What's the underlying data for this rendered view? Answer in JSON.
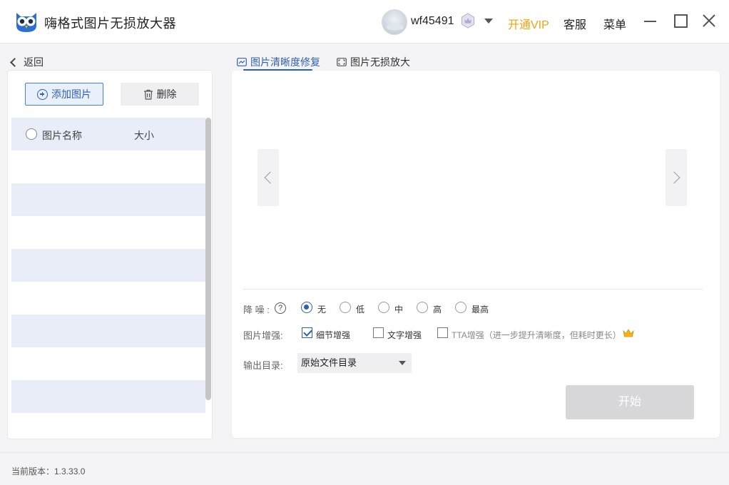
{
  "app": {
    "title": "嗨格式图片无损放大器"
  },
  "account": {
    "username": "wf45491",
    "vip_label": "开通VIP",
    "service_label": "客服",
    "menu_label": "菜单"
  },
  "nav": {
    "back_label": "返回"
  },
  "file_list": {
    "add_label": "添加图片",
    "delete_label": "删除",
    "col_name": "图片名称",
    "col_size": "大小"
  },
  "tabs": [
    {
      "label": "图片清晰度修复",
      "active": true
    },
    {
      "label": "图片无损放大",
      "active": false
    }
  ],
  "options": {
    "denoise_label": "降 噪 :",
    "denoise_levels": [
      "无",
      "低",
      "中",
      "高",
      "最高"
    ],
    "denoise_selected": "无",
    "enhance_label": "图片增强:",
    "enhance_items": [
      {
        "label": "细节增强",
        "checked": true
      },
      {
        "label": "文字增强",
        "checked": false
      },
      {
        "label": "TTA增强（进一步提升清晰度，但耗时更长）",
        "checked": false
      }
    ],
    "output_label": "输出目录:",
    "output_value": "原始文件目录"
  },
  "actions": {
    "start_label": "开始"
  },
  "status": {
    "version": "当前版本：1.3.33.0"
  },
  "colors": {
    "accent": "#2f5fb3",
    "vip": "#f2a10c",
    "list_stripe": "#e9edf7",
    "disabled_button": "#d7d7da"
  },
  "icons": {
    "logo": "owl-logo-icon",
    "badge": "vip-badge-icon",
    "crown": "crown-icon"
  }
}
